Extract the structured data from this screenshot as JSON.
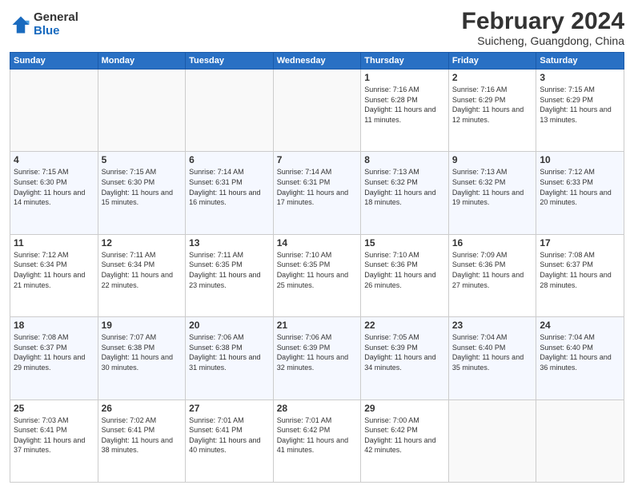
{
  "logo": {
    "general": "General",
    "blue": "Blue"
  },
  "title": {
    "month_year": "February 2024",
    "location": "Suicheng, Guangdong, China"
  },
  "weekdays": [
    "Sunday",
    "Monday",
    "Tuesday",
    "Wednesday",
    "Thursday",
    "Friday",
    "Saturday"
  ],
  "weeks": [
    [
      {
        "day": "",
        "info": ""
      },
      {
        "day": "",
        "info": ""
      },
      {
        "day": "",
        "info": ""
      },
      {
        "day": "",
        "info": ""
      },
      {
        "day": "1",
        "info": "Sunrise: 7:16 AM\nSunset: 6:28 PM\nDaylight: 11 hours and 11 minutes."
      },
      {
        "day": "2",
        "info": "Sunrise: 7:16 AM\nSunset: 6:29 PM\nDaylight: 11 hours and 12 minutes."
      },
      {
        "day": "3",
        "info": "Sunrise: 7:15 AM\nSunset: 6:29 PM\nDaylight: 11 hours and 13 minutes."
      }
    ],
    [
      {
        "day": "4",
        "info": "Sunrise: 7:15 AM\nSunset: 6:30 PM\nDaylight: 11 hours and 14 minutes."
      },
      {
        "day": "5",
        "info": "Sunrise: 7:15 AM\nSunset: 6:30 PM\nDaylight: 11 hours and 15 minutes."
      },
      {
        "day": "6",
        "info": "Sunrise: 7:14 AM\nSunset: 6:31 PM\nDaylight: 11 hours and 16 minutes."
      },
      {
        "day": "7",
        "info": "Sunrise: 7:14 AM\nSunset: 6:31 PM\nDaylight: 11 hours and 17 minutes."
      },
      {
        "day": "8",
        "info": "Sunrise: 7:13 AM\nSunset: 6:32 PM\nDaylight: 11 hours and 18 minutes."
      },
      {
        "day": "9",
        "info": "Sunrise: 7:13 AM\nSunset: 6:32 PM\nDaylight: 11 hours and 19 minutes."
      },
      {
        "day": "10",
        "info": "Sunrise: 7:12 AM\nSunset: 6:33 PM\nDaylight: 11 hours and 20 minutes."
      }
    ],
    [
      {
        "day": "11",
        "info": "Sunrise: 7:12 AM\nSunset: 6:34 PM\nDaylight: 11 hours and 21 minutes."
      },
      {
        "day": "12",
        "info": "Sunrise: 7:11 AM\nSunset: 6:34 PM\nDaylight: 11 hours and 22 minutes."
      },
      {
        "day": "13",
        "info": "Sunrise: 7:11 AM\nSunset: 6:35 PM\nDaylight: 11 hours and 23 minutes."
      },
      {
        "day": "14",
        "info": "Sunrise: 7:10 AM\nSunset: 6:35 PM\nDaylight: 11 hours and 25 minutes."
      },
      {
        "day": "15",
        "info": "Sunrise: 7:10 AM\nSunset: 6:36 PM\nDaylight: 11 hours and 26 minutes."
      },
      {
        "day": "16",
        "info": "Sunrise: 7:09 AM\nSunset: 6:36 PM\nDaylight: 11 hours and 27 minutes."
      },
      {
        "day": "17",
        "info": "Sunrise: 7:08 AM\nSunset: 6:37 PM\nDaylight: 11 hours and 28 minutes."
      }
    ],
    [
      {
        "day": "18",
        "info": "Sunrise: 7:08 AM\nSunset: 6:37 PM\nDaylight: 11 hours and 29 minutes."
      },
      {
        "day": "19",
        "info": "Sunrise: 7:07 AM\nSunset: 6:38 PM\nDaylight: 11 hours and 30 minutes."
      },
      {
        "day": "20",
        "info": "Sunrise: 7:06 AM\nSunset: 6:38 PM\nDaylight: 11 hours and 31 minutes."
      },
      {
        "day": "21",
        "info": "Sunrise: 7:06 AM\nSunset: 6:39 PM\nDaylight: 11 hours and 32 minutes."
      },
      {
        "day": "22",
        "info": "Sunrise: 7:05 AM\nSunset: 6:39 PM\nDaylight: 11 hours and 34 minutes."
      },
      {
        "day": "23",
        "info": "Sunrise: 7:04 AM\nSunset: 6:40 PM\nDaylight: 11 hours and 35 minutes."
      },
      {
        "day": "24",
        "info": "Sunrise: 7:04 AM\nSunset: 6:40 PM\nDaylight: 11 hours and 36 minutes."
      }
    ],
    [
      {
        "day": "25",
        "info": "Sunrise: 7:03 AM\nSunset: 6:41 PM\nDaylight: 11 hours and 37 minutes."
      },
      {
        "day": "26",
        "info": "Sunrise: 7:02 AM\nSunset: 6:41 PM\nDaylight: 11 hours and 38 minutes."
      },
      {
        "day": "27",
        "info": "Sunrise: 7:01 AM\nSunset: 6:41 PM\nDaylight: 11 hours and 40 minutes."
      },
      {
        "day": "28",
        "info": "Sunrise: 7:01 AM\nSunset: 6:42 PM\nDaylight: 11 hours and 41 minutes."
      },
      {
        "day": "29",
        "info": "Sunrise: 7:00 AM\nSunset: 6:42 PM\nDaylight: 11 hours and 42 minutes."
      },
      {
        "day": "",
        "info": ""
      },
      {
        "day": "",
        "info": ""
      }
    ]
  ]
}
